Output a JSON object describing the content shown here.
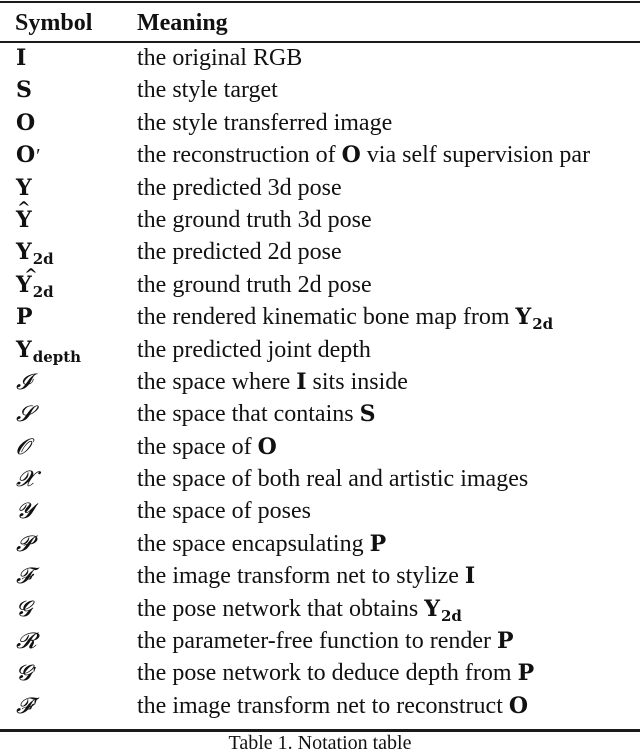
{
  "table": {
    "headers": {
      "symbol": "Symbol",
      "meaning": "Meaning"
    },
    "rows": [
      {
        "symbol": "I",
        "symbol_style": "bold",
        "meaning": [
          {
            "t": "the original RGB"
          }
        ]
      },
      {
        "symbol": "S",
        "symbol_style": "bold",
        "meaning": [
          {
            "t": "the style target"
          }
        ]
      },
      {
        "symbol": "O",
        "symbol_style": "bold",
        "meaning": [
          {
            "t": "the style transferred image"
          }
        ]
      },
      {
        "symbol": "O",
        "symbol_style": "bold",
        "prime": true,
        "meaning": [
          {
            "t": "the reconstruction of "
          },
          {
            "t": "O",
            "b": true
          },
          {
            "t": " via self supervision par"
          }
        ]
      },
      {
        "symbol": "Y",
        "symbol_style": "bold",
        "meaning": [
          {
            "t": "the predicted 3d pose"
          }
        ]
      },
      {
        "symbol": "Y",
        "symbol_style": "bold",
        "hat": true,
        "meaning": [
          {
            "t": "the ground truth 3d pose"
          }
        ]
      },
      {
        "symbol": "Y",
        "symbol_style": "bold",
        "sub": "2d",
        "meaning": [
          {
            "t": "the predicted 2d pose"
          }
        ]
      },
      {
        "symbol": "Y",
        "symbol_style": "bold",
        "sub": "2d",
        "hat_offset": true,
        "meaning": [
          {
            "t": "the ground truth 2d pose"
          }
        ]
      },
      {
        "symbol": "P",
        "symbol_style": "bold",
        "meaning": [
          {
            "t": "the rendered kinematic bone map from "
          },
          {
            "t": "Y",
            "b": true,
            "sub": "2d"
          }
        ]
      },
      {
        "symbol": "Y",
        "symbol_style": "bold",
        "sub": "depth",
        "meaning": [
          {
            "t": "the predicted joint depth"
          }
        ]
      },
      {
        "symbol": "𝓘",
        "symbol_style": "cal",
        "meaning": [
          {
            "t": "the space where "
          },
          {
            "t": "I",
            "b": true
          },
          {
            "t": " sits inside"
          }
        ]
      },
      {
        "symbol": "𝓢",
        "symbol_style": "cal",
        "meaning": [
          {
            "t": "the space that contains "
          },
          {
            "t": "S",
            "b": true
          }
        ]
      },
      {
        "symbol": "𝓞",
        "symbol_style": "cal",
        "meaning": [
          {
            "t": "the space of "
          },
          {
            "t": "O",
            "b": true
          }
        ]
      },
      {
        "symbol": "𝓧",
        "symbol_style": "cal",
        "meaning": [
          {
            "t": "the space of both real and artistic images"
          }
        ]
      },
      {
        "symbol": "𝓨",
        "symbol_style": "cal",
        "meaning": [
          {
            "t": "the space of poses"
          }
        ]
      },
      {
        "symbol": "𝓟",
        "symbol_style": "cal",
        "meaning": [
          {
            "t": "the space encapsulating "
          },
          {
            "t": "P",
            "b": true
          }
        ]
      },
      {
        "symbol": "𝓕",
        "symbol_style": "cal",
        "meaning": [
          {
            "t": "the image transform net to stylize "
          },
          {
            "t": "I",
            "b": true
          }
        ]
      },
      {
        "symbol": "𝓖",
        "symbol_style": "cal",
        "meaning": [
          {
            "t": "the pose network that obtains "
          },
          {
            "t": "Y",
            "b": true,
            "sub": "2d"
          }
        ]
      },
      {
        "symbol": "𝓡",
        "symbol_style": "cal",
        "meaning": [
          {
            "t": "the parameter-free function to render "
          },
          {
            "t": "P",
            "b": true
          }
        ]
      },
      {
        "symbol": "𝓖",
        "symbol_style": "cal",
        "prime": true,
        "meaning": [
          {
            "t": "the pose network to deduce depth from "
          },
          {
            "t": "P",
            "b": true
          }
        ]
      },
      {
        "symbol": "𝓕",
        "symbol_style": "cal",
        "prime": true,
        "meaning": [
          {
            "t": "the image transform net to reconstruct "
          },
          {
            "t": "O",
            "b": true
          }
        ]
      }
    ]
  },
  "caption": "Table 1. Notation table"
}
